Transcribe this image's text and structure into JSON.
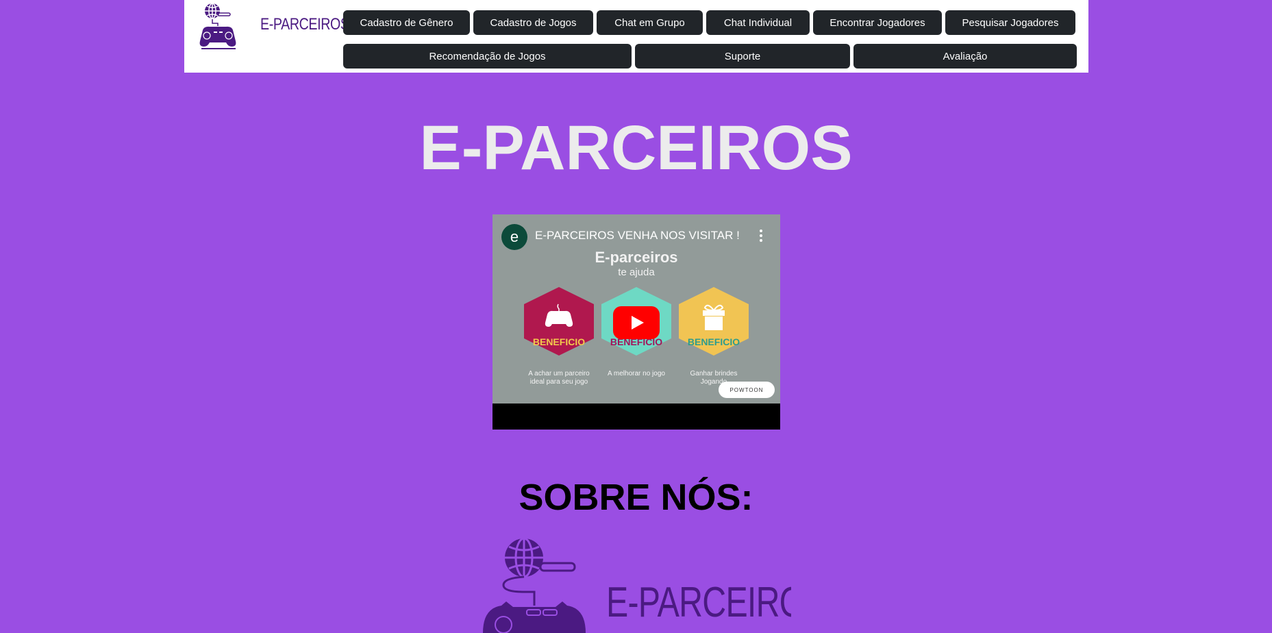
{
  "brand": {
    "name": "E-PARCEIROS",
    "logo_icon": "globe-gamepad-icon",
    "color": "#4b1a82"
  },
  "nav": {
    "row1": [
      {
        "label": "Cadastro de Gênero"
      },
      {
        "label": "Cadastro de Jogos"
      },
      {
        "label": "Chat em Grupo"
      },
      {
        "label": "Chat Individual"
      },
      {
        "label": "Encontrar Jogadores"
      },
      {
        "label": "Pesquisar Jogadores"
      }
    ],
    "row2": [
      {
        "label": "Recomendação de Jogos"
      },
      {
        "label": "Suporte"
      },
      {
        "label": "Avaliação"
      }
    ]
  },
  "hero": {
    "title": "E-PARCEIROS"
  },
  "video": {
    "channel_initial": "e",
    "title": "E-PARCEIROS VENHA NOS VISITAR !",
    "heading": "E-parceiros",
    "subheading": "te ajuda",
    "cards": [
      {
        "label": "BENEFICIO",
        "caption": "A achar um parceiro ideal para seu jogo",
        "icon": "gamepad-icon",
        "color": "#b0184e",
        "label_color": "#f2c94c"
      },
      {
        "label": "BENEFICIO",
        "caption": "A melhorar no jogo",
        "icon": "youtube-play-icon",
        "color": "#6ed9c4",
        "label_color": "#a3145a"
      },
      {
        "label": "BENEFICIO",
        "caption": "Ganhar brindes Jogando",
        "icon": "gift-icon",
        "color": "#f1c453",
        "label_color": "#2f9c8c"
      }
    ],
    "watermark": "POWTOON"
  },
  "about": {
    "title": "SOBRE NÓS:",
    "logo_text": "E-PARCEIROS"
  },
  "colors": {
    "background": "#9a4ee3",
    "nav_button": "#212529",
    "hero_text": "#ececec"
  }
}
